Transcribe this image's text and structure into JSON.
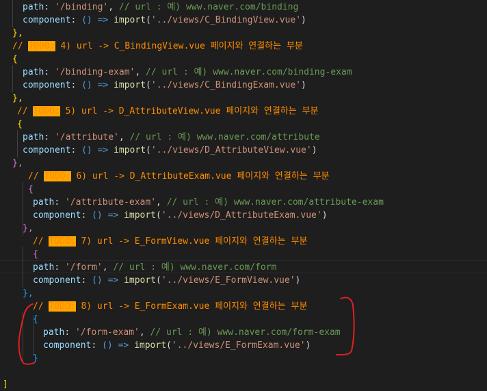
{
  "editor": {
    "colors": {
      "background": "#1e1e1e",
      "comment": "#6a9955",
      "todo_comment": "#ff8c00",
      "todo_highlight": "#ffa500",
      "property": "#9cdcfe",
      "string": "#ce9178",
      "keyword": "#569cd6",
      "function": "#dcdcaa",
      "annotation_red": "#e02020"
    },
    "tokens": {
      "path_key": "path",
      "component_key": "component",
      "arrow": "() =>",
      "import_fn": "import",
      "todo": "TODO:",
      "comment_slash": "//",
      "url_prefix": "// url : 예)"
    },
    "lines": [
      {
        "kind": "route",
        "path": "'/binding'",
        "url": "www.naver.com/binding"
      },
      {
        "kind": "component",
        "value": "'../views/C_BindingView.vue'"
      },
      {
        "kind": "close",
        "text": "},"
      },
      {
        "kind": "todo",
        "text": "4) url -> C_BindingView.vue 페이지와 연결하는 부분"
      },
      {
        "kind": "open",
        "text": "{"
      },
      {
        "kind": "route",
        "path": "'/binding-exam'",
        "url": "www.naver.com/binding-exam"
      },
      {
        "kind": "component",
        "value": "'../views/C_BindingExam.vue'"
      },
      {
        "kind": "close",
        "text": "},"
      },
      {
        "kind": "todo",
        "text": "5) url -> D_AttributeView.vue 페이지와 연결하는 부분"
      },
      {
        "kind": "open",
        "text": "{"
      },
      {
        "kind": "route",
        "path": "'/attribute'",
        "url": "www.naver.com/attribute"
      },
      {
        "kind": "component",
        "value": "'../views/D_AttributeView.vue'"
      },
      {
        "kind": "close",
        "text": "},"
      },
      {
        "kind": "todo",
        "text": "6) url -> D_AttributeExam.vue 페이지와 연결하는 부분"
      },
      {
        "kind": "open",
        "text": "{"
      },
      {
        "kind": "route",
        "path": "'/attribute-exam'",
        "url": "www.naver.com/attribute-exam"
      },
      {
        "kind": "component",
        "value": "'../views/D_AttributeExam.vue'"
      },
      {
        "kind": "close",
        "text": "},"
      },
      {
        "kind": "todo",
        "text": "7) url -> E_FormView.vue 페이지와 연결하는 부분"
      },
      {
        "kind": "open",
        "text": "{"
      },
      {
        "kind": "route",
        "path": "'/form'",
        "url": "www.naver.com/form"
      },
      {
        "kind": "component",
        "value": "'../views/E_FormView.vue'"
      },
      {
        "kind": "close",
        "text": "},"
      },
      {
        "kind": "todo",
        "text": "8) url -> E_FormExam.vue 페이지와 연결하는 부분"
      },
      {
        "kind": "open",
        "text": "{"
      },
      {
        "kind": "route",
        "path": "'/form-exam'",
        "url": "www.naver.com/form-exam"
      },
      {
        "kind": "component",
        "value": "'../views/E_FormExam.vue'"
      },
      {
        "kind": "close",
        "text": "}"
      },
      {
        "kind": "blank",
        "text": ""
      },
      {
        "kind": "array_close",
        "text": "]"
      }
    ]
  }
}
